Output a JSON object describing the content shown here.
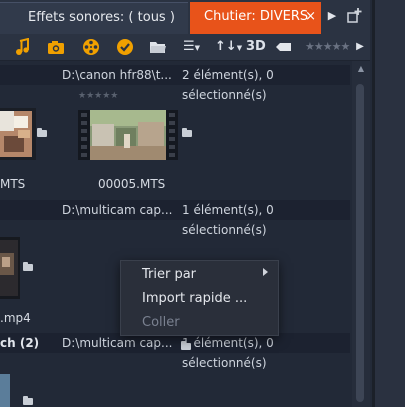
{
  "tabs": [
    {
      "label": "Effets sonores: ( tous )",
      "active": false
    },
    {
      "label": "Chutier: DIVERS",
      "active": true,
      "close": "×"
    }
  ],
  "toolbar": {
    "icons": [
      "music-note-icon",
      "camera-icon",
      "film-reel-icon",
      "checkmark-circle-icon",
      "folder-open-icon"
    ],
    "sort_glyph": "↑↓",
    "list_glyph": "☰",
    "threed_label": "3D",
    "stars": "★★★★★",
    "colors": {
      "accent": "#e8531a",
      "icon": "#f0a000"
    }
  },
  "groups": [
    {
      "name": "",
      "path": "D:\\canon hfr88\\t...",
      "info": "2 élément(s), 0 sélectionné(s)"
    },
    {
      "name": "",
      "path": "D:\\multicam cap...",
      "info": "1 élément(s), 0 sélectionné(s)"
    },
    {
      "name": "ch (2)",
      "path": "D:\\multicam cap...",
      "info": "1 élément(s), 0 sélectionné(s)"
    }
  ],
  "items": [
    {
      "label": "MTS",
      "stars": ""
    },
    {
      "label": "00005.MTS",
      "stars": "★★★★★"
    },
    {
      "label": ".mp4",
      "stars": ""
    }
  ],
  "context_menu": {
    "items": [
      {
        "label": "Trier par",
        "submenu": true,
        "enabled": true
      },
      {
        "label": "Import rapide ...",
        "submenu": false,
        "enabled": true
      },
      {
        "label": "Coller",
        "submenu": false,
        "enabled": false
      }
    ]
  }
}
